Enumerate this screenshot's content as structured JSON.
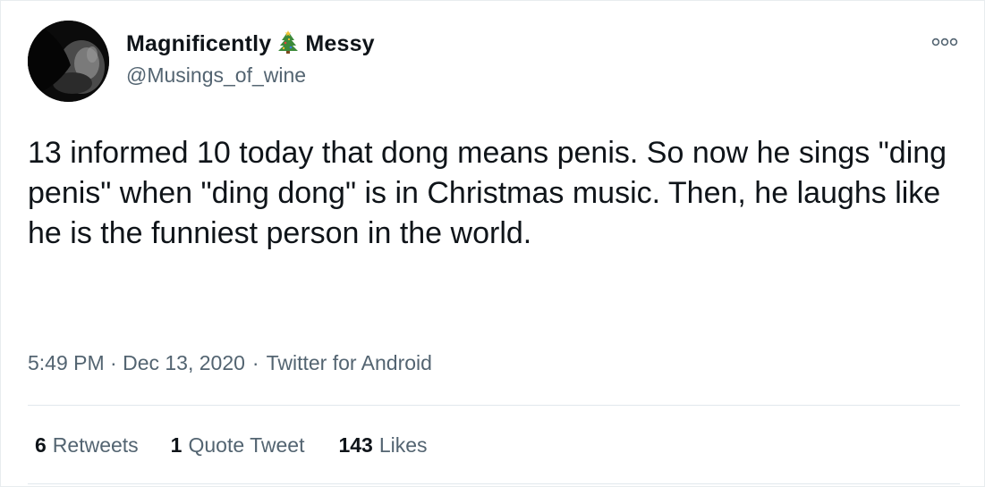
{
  "author": {
    "name_part1": "Magnificently",
    "name_emoji_icon": "christmas-tree-icon",
    "name_part2": "Messy",
    "handle": "@Musings_of_wine"
  },
  "tweet": {
    "text": "13 informed 10 today that dong means penis. So now he sings \"ding penis\" when \"ding dong\" is in Christmas music. Then, he laughs like he is the funniest person in the world.",
    "time_date": "5:49 PM · Dec 13, 2020",
    "separator": "·",
    "source": "Twitter for Android"
  },
  "stats": {
    "retweets_count": "6",
    "retweets_label": "Retweets",
    "quotes_count": "1",
    "quotes_label": "Quote Tweet",
    "likes_count": "143",
    "likes_label": "Likes"
  },
  "icons": {
    "more": "more-options-icon"
  },
  "colors": {
    "text_primary": "#0f1419",
    "text_secondary": "#536471",
    "divider": "#e1e8ed"
  }
}
